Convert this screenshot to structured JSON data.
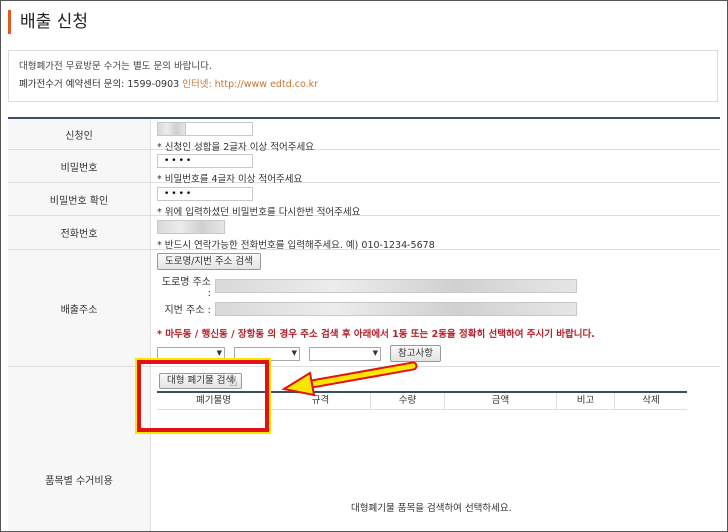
{
  "page": {
    "title": "배출 신청"
  },
  "notice": {
    "line1": "대형폐가전 무료방문 수거는 별도 문의 바랍니다.",
    "line2_prefix": "폐가전수거 예약센터 문의: 1599-0903",
    "line2_web": "인터넷: http://www edtd.co.kr"
  },
  "form": {
    "applicant": {
      "label": "신청인",
      "hint": "* 신청인 성함을 2글자 이상 적어주세요"
    },
    "password": {
      "label": "비밀번호",
      "value": "••••",
      "hint": "* 비밀번호를 4글자 이상 적어주세요"
    },
    "password_confirm": {
      "label": "비밀번호 확인",
      "value": "••••",
      "hint": "* 위에 입력하셨던 비밀번호를 다시한번 적어주세요"
    },
    "phone": {
      "label": "전화번호",
      "hint": "* 반드시 연락가능한 전화번호를 입력해주세요. 예) 010-1234-5678"
    },
    "address": {
      "label": "배출주소",
      "search_button": "도로명/지번 주소 검색",
      "road_label": "도로명 주소 :",
      "lot_label": "지번 주소 :",
      "warning": "* 마두동 / 행신동 / 장항동 의 경우 주소 검색 후 아래에서 1동 또는 2동을 정확히 선택하여 주시기 바랍니다.",
      "reference_button": "참고사항"
    },
    "items": {
      "label": "품목별 수거비용",
      "search_button": "대형 폐기물 검색",
      "columns": [
        "폐기물명",
        "규격",
        "수량",
        "금액",
        "비고",
        "삭제"
      ],
      "empty_message": "대형폐기물 품목을 검색하여 선택하세요."
    }
  },
  "colors": {
    "accent": "#e05a1e",
    "header_border": "#3d4d66",
    "warning": "#b5202b",
    "highlight": "#e21212",
    "arrow": "#ffe600"
  }
}
